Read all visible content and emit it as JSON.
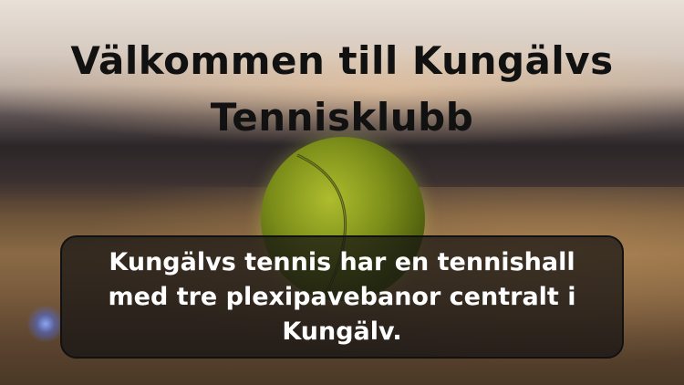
{
  "hero": {
    "title_line1": "Välkommen till Kungälvs",
    "title_line2": "Tennisklubb",
    "description": "Kungälvs tennis har en tennishall med tre plexipavebanor centralt i Kungälv."
  },
  "colors": {
    "title_text": "#111111",
    "box_background": "#141212",
    "box_text": "#ffffff",
    "ball": "#7d8f1a"
  },
  "icons": {
    "background_image": "tennis-ball-on-court-photo"
  }
}
